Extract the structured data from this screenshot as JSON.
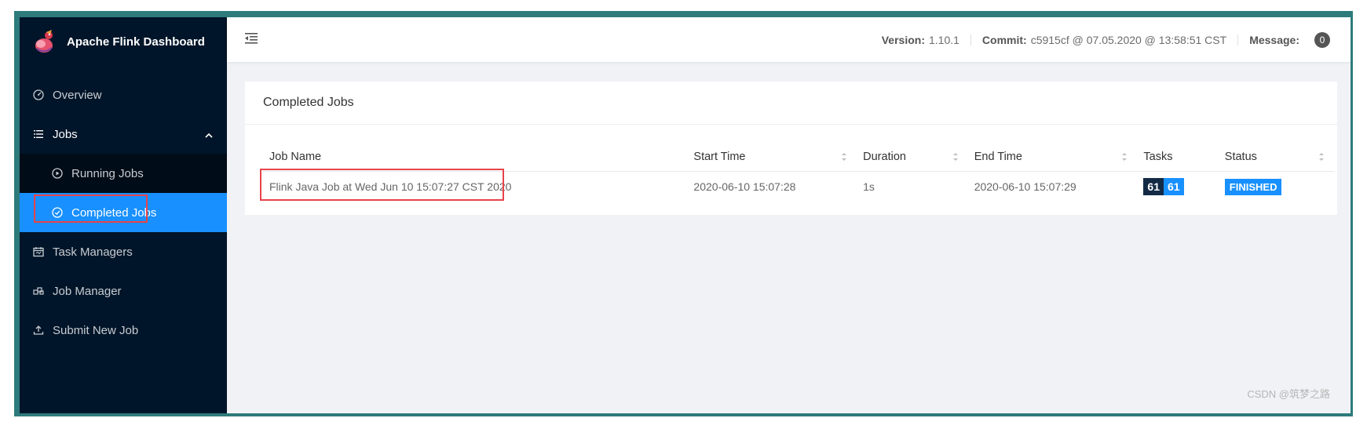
{
  "app": {
    "title": "Apache Flink Dashboard"
  },
  "sidebar": {
    "items": [
      {
        "label": "Overview",
        "icon": "dashboard-icon"
      },
      {
        "label": "Jobs",
        "icon": "list-icon"
      },
      {
        "label": "Task Managers",
        "icon": "calendar-icon"
      },
      {
        "label": "Job Manager",
        "icon": "cluster-icon"
      },
      {
        "label": "Submit New Job",
        "icon": "upload-icon"
      }
    ],
    "jobs_submenu": [
      {
        "label": "Running Jobs",
        "icon": "play-circle-icon"
      },
      {
        "label": "Completed Jobs",
        "icon": "check-circle-icon",
        "active": true
      }
    ]
  },
  "header": {
    "version_label": "Version:",
    "version_value": "1.10.1",
    "commit_label": "Commit:",
    "commit_value": "c5915cf @ 07.05.2020 @ 13:58:51 CST",
    "message_label": "Message:",
    "message_count": "0"
  },
  "card": {
    "title": "Completed Jobs"
  },
  "table": {
    "columns": [
      "Job Name",
      "Start Time",
      "Duration",
      "End Time",
      "Tasks",
      "Status"
    ],
    "rows": [
      {
        "job_name": "Flink Java Job at Wed Jun 10 15:07:27 CST 2020",
        "start_time": "2020-06-10 15:07:28",
        "duration": "1s",
        "end_time": "2020-06-10 15:07:29",
        "tasks_total": "61",
        "tasks_finished": "61",
        "status": "FINISHED"
      }
    ]
  },
  "colors": {
    "sidebar_bg": "#001529",
    "accent": "#1890ff",
    "highlight_box": "#e8434a",
    "frame": "#2e7b7b"
  },
  "watermark": "CSDN @筑梦之路"
}
